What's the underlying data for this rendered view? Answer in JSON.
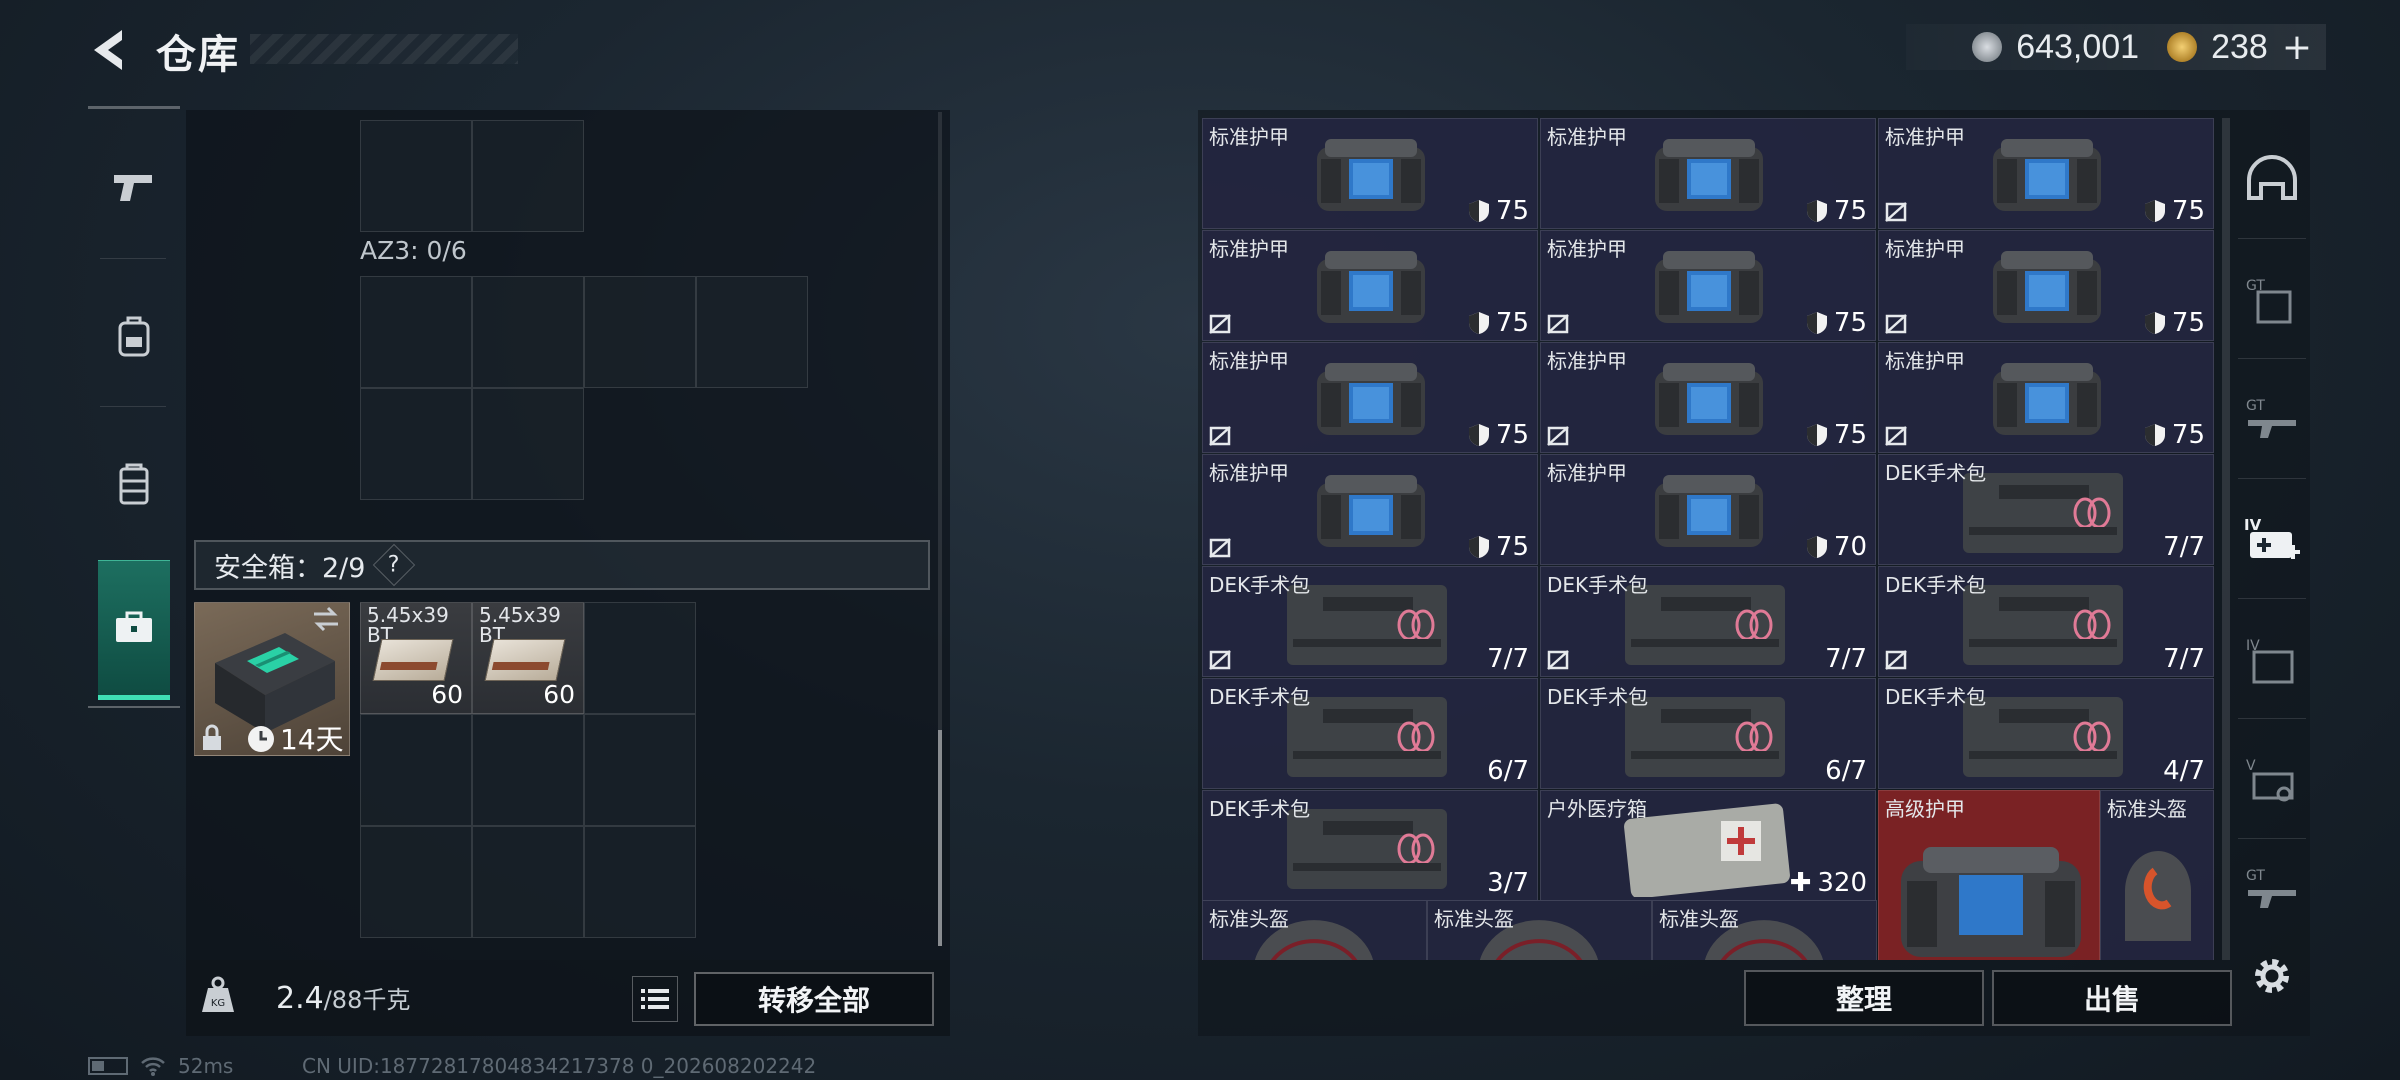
{
  "header": {
    "title": "仓库",
    "currency_silver": "643,001",
    "currency_gold": "238",
    "plus": "+"
  },
  "left": {
    "az3_label": "AZ3: 0/6",
    "safe_box_label": "安全箱：2/9",
    "safe_box_help": "?",
    "safe_box_days": "14天",
    "ammo": [
      {
        "name": "5.45x39\nBT",
        "count": "60"
      },
      {
        "name": "5.45x39\nBT",
        "count": "60"
      }
    ],
    "weight_value": "2.4",
    "weight_limit": "/88千克",
    "transfer_all": "转移全部"
  },
  "status": {
    "ping": "52ms",
    "uid": "CN UID:18772817804834217378 0_202608202242"
  },
  "stash": {
    "cells": [
      {
        "name": "标准护甲",
        "type": "vest",
        "value": "75",
        "lock": false
      },
      {
        "name": "标准护甲",
        "type": "vest",
        "value": "75",
        "lock": false
      },
      {
        "name": "标准护甲",
        "type": "vest",
        "value": "75",
        "lock": true
      },
      {
        "name": "标准护甲",
        "type": "vest",
        "value": "75",
        "lock": true
      },
      {
        "name": "标准护甲",
        "type": "vest",
        "value": "75",
        "lock": true
      },
      {
        "name": "标准护甲",
        "type": "vest",
        "value": "75",
        "lock": true
      },
      {
        "name": "标准护甲",
        "type": "vest",
        "value": "75",
        "lock": true
      },
      {
        "name": "标准护甲",
        "type": "vest",
        "value": "75",
        "lock": true
      },
      {
        "name": "标准护甲",
        "type": "vest",
        "value": "75",
        "lock": true
      },
      {
        "name": "标准护甲",
        "type": "vest",
        "value": "75",
        "lock": true
      },
      {
        "name": "标准护甲",
        "type": "vest",
        "value": "70",
        "lock": false
      },
      {
        "name": "DEK手术包",
        "type": "kit",
        "value": "7/7",
        "lock": false
      },
      {
        "name": "DEK手术包",
        "type": "kit",
        "value": "7/7",
        "lock": true
      },
      {
        "name": "DEK手术包",
        "type": "kit",
        "value": "7/7",
        "lock": true
      },
      {
        "name": "DEK手术包",
        "type": "kit",
        "value": "7/7",
        "lock": true
      },
      {
        "name": "DEK手术包",
        "type": "kit",
        "value": "6/7",
        "lock": false
      },
      {
        "name": "DEK手术包",
        "type": "kit",
        "value": "6/7",
        "lock": false
      },
      {
        "name": "DEK手术包",
        "type": "kit",
        "value": "4/7",
        "lock": false
      },
      {
        "name": "DEK手术包",
        "type": "kit",
        "value": "3/7",
        "lock": false
      },
      {
        "name": "户外医疗箱",
        "type": "medbox",
        "value": "320",
        "lock": false
      }
    ],
    "high_armor": {
      "name": "高级护甲"
    },
    "std_helmet_side": {
      "name": "标准头盔"
    },
    "helmets": [
      "标准头盔",
      "标准头盔",
      "标准头盔"
    ],
    "sort_label": "整理",
    "sell_label": "出售"
  },
  "right_tabs": [
    "helmet-tab",
    "t3-armor-tab",
    "t3-rig-tab",
    "t4-med-tab",
    "t4-storage-tab",
    "t5-tab",
    "t3-gun-tab"
  ],
  "colors": {
    "accent": "#3fe0b5",
    "cell_bg": "#24263f",
    "high_tier_bg": "#7a2224"
  }
}
